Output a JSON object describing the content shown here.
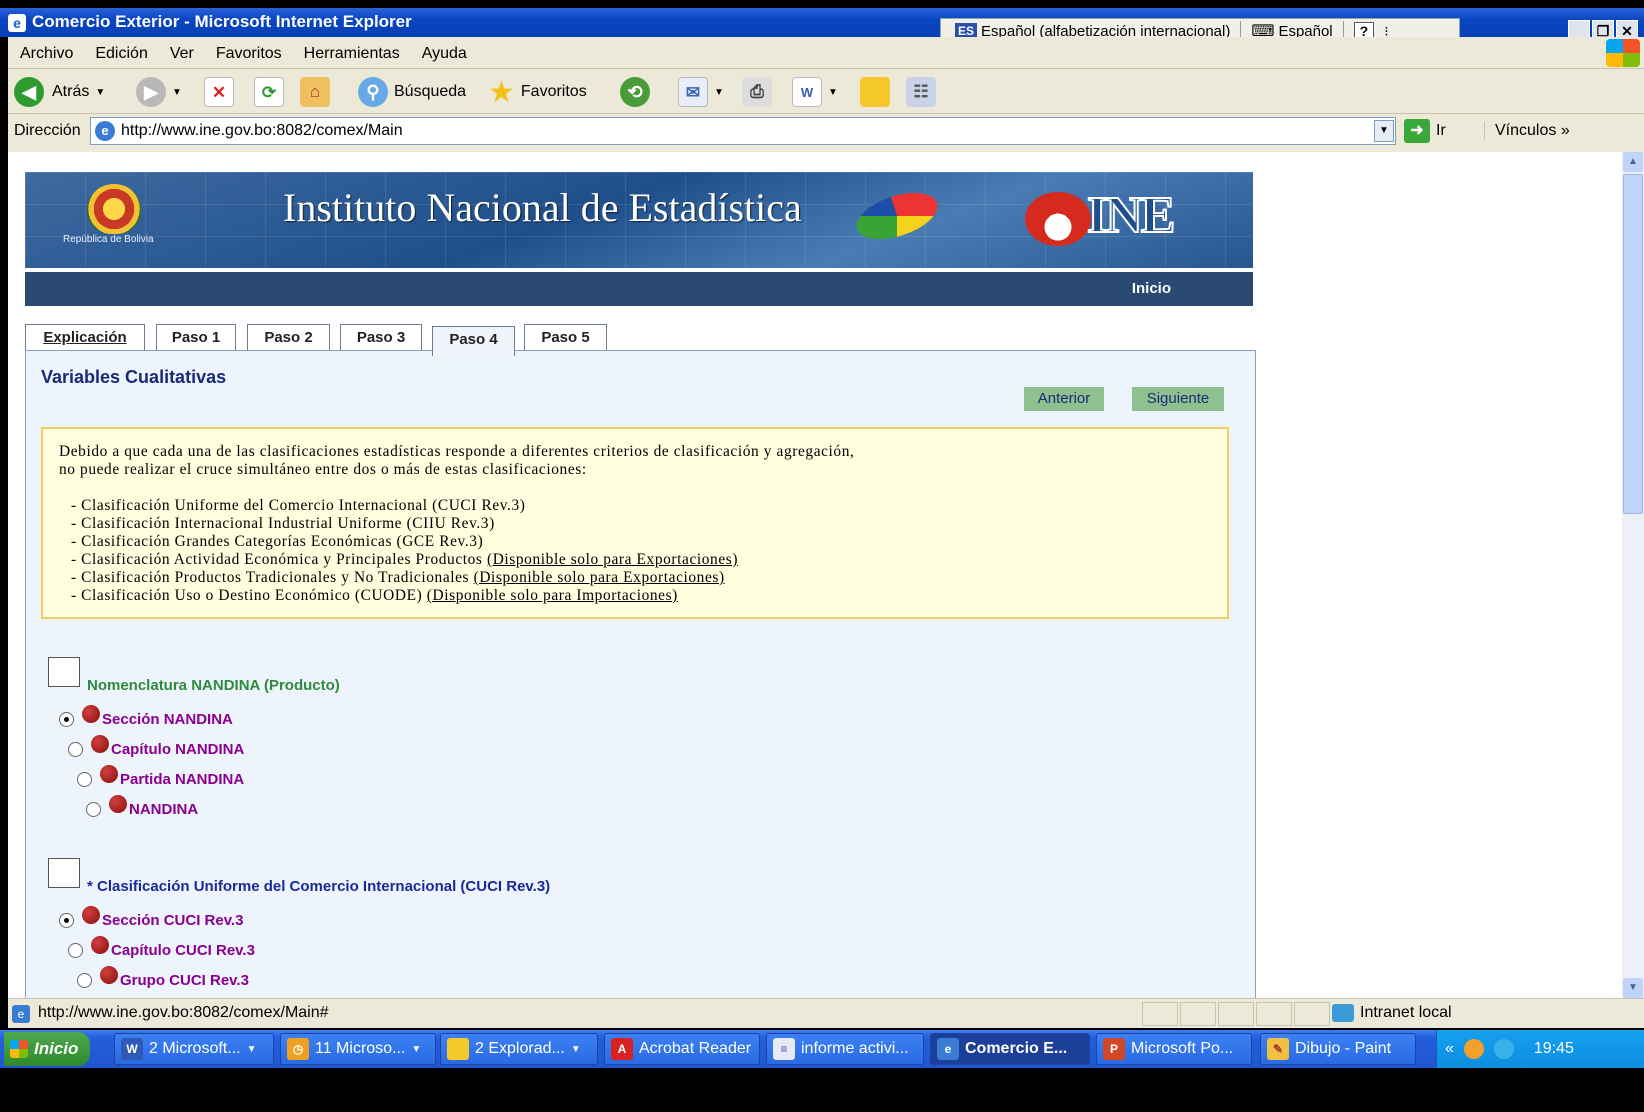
{
  "window": {
    "title": "Comercio Exterior - Microsoft Internet Explorer",
    "language_code": "ES",
    "language_label": "Español (alfabetización internacional)",
    "keyboard_label": "Español",
    "help": "?"
  },
  "menu": [
    "Archivo",
    "Edición",
    "Ver",
    "Favoritos",
    "Herramientas",
    "Ayuda"
  ],
  "toolbar": {
    "back": "Atrás",
    "search": "Búsqueda",
    "favorites": "Favoritos"
  },
  "address": {
    "label": "Dirección",
    "url": "http://www.ine.gov.bo:8082/comex/Main",
    "go": "Ir",
    "links": "Vínculos"
  },
  "banner": {
    "crest_caption": "República de Bolivia",
    "title": "Instituto Nacional de Estadística",
    "logo": "INE"
  },
  "nav": {
    "home": "Inicio"
  },
  "tabs": [
    "Explicación",
    "Paso 1",
    "Paso 2",
    "Paso 3",
    "Paso 4",
    "Paso 5"
  ],
  "panel": {
    "heading": "Variables Cualitativas",
    "prev": "Anterior",
    "next": "Siguiente"
  },
  "notice": {
    "line1": "Debido a que cada una de las clasificaciones estadísticas responde a diferentes criterios de clasificación y agregación,",
    "line2": "no puede realizar el cruce simultáneo entre dos o más de estas clasificaciones:",
    "items": [
      "- Clasificación Uniforme del Comercio Internacional (CUCI Rev.3)",
      "- Clasificación Internacional Industrial Uniforme (CIIU Rev.3)",
      "- Clasificación Grandes Categorías Económicas (GCE Rev.3)",
      "- Clasificación Actividad Económica y Principales Productos ",
      "- Clasificación Productos Tradicionales y No Tradicionales ",
      "- Clasificación Uso o Destino Económico (CUODE) "
    ],
    "notes": [
      "(Disponible solo para Exportaciones)",
      "(Disponible solo para Exportaciones)",
      "(Disponible solo para Importaciones)"
    ]
  },
  "groups": [
    {
      "title": "Nomenclatura NANDINA (Producto)",
      "options": [
        "Sección NANDINA",
        "Capítulo NANDINA",
        "Partida NANDINA",
        "NANDINA"
      ],
      "selected": 0,
      "color": "#2e8b3d"
    },
    {
      "title": "* Clasificación Uniforme del Comercio Internacional (CUCI Rev.3)",
      "options": [
        "Sección CUCI Rev.3",
        "Capítulo CUCI Rev.3",
        "Grupo CUCI Rev.3"
      ],
      "selected": 0,
      "color": "#1a2a9a"
    }
  ],
  "status": {
    "url": "http://www.ine.gov.bo:8082/comex/Main#",
    "zone": "Intranet local"
  },
  "taskbar": {
    "start": "Inicio",
    "tasks": [
      "2 Microsoft...",
      "11 Microso...",
      "2 Explorad...",
      "Acrobat Reader",
      "informe activi...",
      "Comercio E...",
      "Microsoft Po...",
      "Dibujo - Paint"
    ],
    "tray_arrow": "«",
    "clock": "19:45"
  }
}
